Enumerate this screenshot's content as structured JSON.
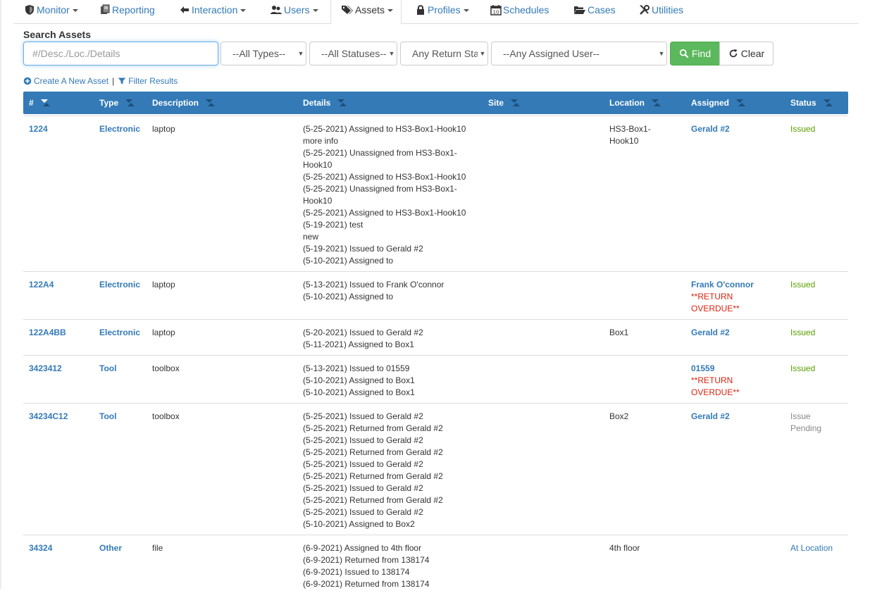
{
  "nav": {
    "monitor": "Monitor",
    "reporting": "Reporting",
    "interaction": "Interaction",
    "users": "Users",
    "assets": "Assets",
    "profiles": "Profiles",
    "schedules": "Schedules",
    "cases": "Cases",
    "utilities": "Utilities"
  },
  "search": {
    "label": "Search Assets",
    "placeholder": "#/Desc./Loc./Details",
    "type_filter": "--All Types--",
    "status_filter": "--All Statuses--",
    "return_filter": "Any Return Status",
    "user_filter": "--Any Assigned User--",
    "find_label": "Find",
    "clear_label": "Clear"
  },
  "actions": {
    "create": "Create A New Asset",
    "separator": "|",
    "filter": "Filter Results"
  },
  "table": {
    "headers": [
      "#",
      "Type",
      "Description",
      "Details",
      "Site",
      "Location",
      "Assigned",
      "Status"
    ],
    "rows": [
      {
        "id": "1224",
        "type": "Electronic",
        "description": "laptop",
        "details": [
          "(5-25-2021) Assigned to HS3-Box1-Hook10",
          "more info",
          "(5-25-2021) Unassigned from HS3-Box1-",
          "Hook10",
          "(5-25-2021) Assigned to HS3-Box1-Hook10",
          "(5-25-2021) Unassigned from HS3-Box1-",
          "Hook10",
          "(5-25-2021) Assigned to HS3-Box1-Hook10",
          "(5-19-2021) test",
          "new",
          "(5-19-2021) Issued to Gerald #2",
          "(5-10-2021) Assigned to"
        ],
        "site": "",
        "location": [
          "HS3-Box1-",
          "Hook10"
        ],
        "assigned": "Gerald #2",
        "overdue": [
          "",
          ""
        ],
        "status": [
          "Issued",
          ""
        ],
        "status_style": "green"
      },
      {
        "id": "122A4",
        "type": "Electronic",
        "description": "laptop",
        "details": [
          "(5-13-2021) Issued to Frank O'connor",
          "(5-10-2021) Assigned to"
        ],
        "site": "",
        "location": [
          "",
          ""
        ],
        "assigned": "Frank O'connor",
        "overdue": [
          "**RETURN",
          "OVERDUE**"
        ],
        "status": [
          "Issued",
          ""
        ],
        "status_style": "green"
      },
      {
        "id": "122A4BB",
        "type": "Electronic",
        "description": "laptop",
        "details": [
          "(5-20-2021) Issued to Gerald #2",
          "(5-11-2021) Assigned to Box1"
        ],
        "site": "",
        "location": [
          "Box1",
          ""
        ],
        "assigned": "Gerald #2",
        "overdue": [
          "",
          ""
        ],
        "status": [
          "Issued",
          ""
        ],
        "status_style": "green"
      },
      {
        "id": "3423412",
        "type": "Tool",
        "description": "toolbox",
        "details": [
          "(5-13-2021) Issued to 01559",
          "(5-10-2021) Assigned to Box1",
          "(5-10-2021) Assigned to Box1"
        ],
        "site": "",
        "location": [
          "",
          ""
        ],
        "assigned": "01559",
        "overdue": [
          "**RETURN",
          "OVERDUE**"
        ],
        "status": [
          "Issued",
          ""
        ],
        "status_style": "green"
      },
      {
        "id": "34234C12",
        "type": "Tool",
        "description": "toolbox",
        "details": [
          "(5-25-2021) Issued to Gerald #2",
          "(5-25-2021) Returned from Gerald #2",
          "(5-25-2021) Issued to Gerald #2",
          "(5-25-2021) Returned from Gerald #2",
          "(5-25-2021) Issued to Gerald #2",
          "(5-25-2021) Returned from Gerald #2",
          "(5-25-2021) Issued to Gerald #2",
          "(5-25-2021) Returned from Gerald #2",
          "(5-25-2021) Issued to Gerald #2",
          "(5-10-2021) Assigned to Box2"
        ],
        "site": "",
        "location": [
          "Box2",
          ""
        ],
        "assigned": "Gerald #2",
        "overdue": [
          "",
          ""
        ],
        "status": [
          "Issue",
          "Pending"
        ],
        "status_style": "gray"
      },
      {
        "id": "34324",
        "type": "Other",
        "description": "file",
        "details": [
          "(6-9-2021) Assigned to 4th floor",
          "(6-9-2021) Returned from 138174",
          "(6-9-2021) Issued to 138174",
          "(6-9-2021) Returned from 138174"
        ],
        "site": "",
        "location": [
          "4th floor",
          ""
        ],
        "assigned": "",
        "overdue": [
          "",
          ""
        ],
        "status": [
          "At Location",
          ""
        ],
        "status_style": "blue"
      }
    ]
  }
}
